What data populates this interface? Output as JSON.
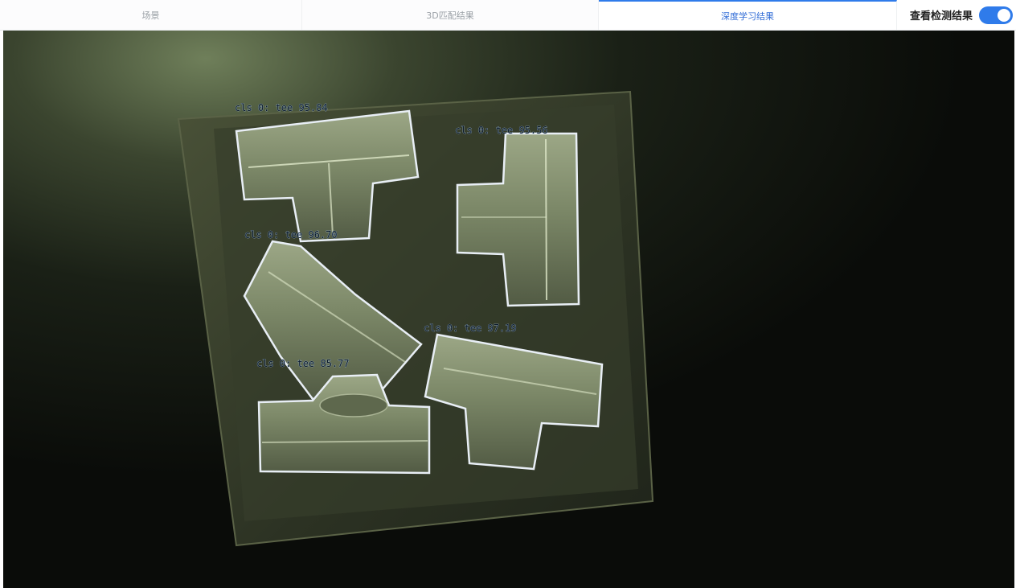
{
  "tabs": [
    {
      "label": "场景",
      "active": false
    },
    {
      "label": "3D匹配结果",
      "active": false
    },
    {
      "label": "深度学习结果",
      "active": true
    }
  ],
  "toggle": {
    "label": "查看检测结果",
    "on": true
  },
  "detections": [
    {
      "label": "cls 0: tee 95.84"
    },
    {
      "label": "cls 0: tee 95.56"
    },
    {
      "label": "cls 0: tee 96.70"
    },
    {
      "label": "cls 0: tee 97.19"
    },
    {
      "label": "cls 0: tee 85.77"
    }
  ],
  "colors": {
    "accent": "#2f7bea",
    "contour": "#e8eef5"
  }
}
